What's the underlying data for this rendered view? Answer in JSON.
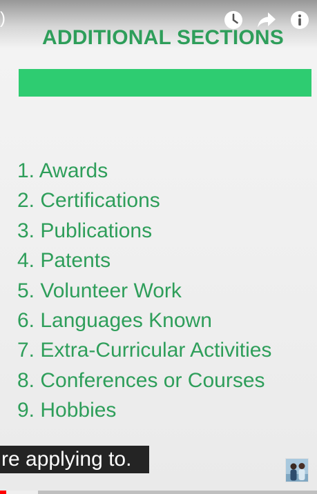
{
  "player": {
    "title_fragment": ")",
    "icons": {
      "watch_later": "clock-icon",
      "share": "share-arrow-icon",
      "info": "info-icon"
    }
  },
  "slide": {
    "title": "ADDITIONAL SECTIONS",
    "accent_color": "#2ecc71",
    "text_color": "#2e9e5a",
    "items": [
      "1. Awards",
      "2. Certifications",
      "3. Publications",
      "4. Patents",
      "5. Volunteer Work",
      "6. Languages Known",
      "7. Extra-Curricular Activities",
      "8. Conferences or Courses",
      "9. Hobbies"
    ]
  },
  "caption": {
    "text": "re applying to."
  },
  "progress": {
    "played_fraction": 0.02,
    "buffered_fraction": 0.12,
    "played_color": "#ff0000"
  }
}
